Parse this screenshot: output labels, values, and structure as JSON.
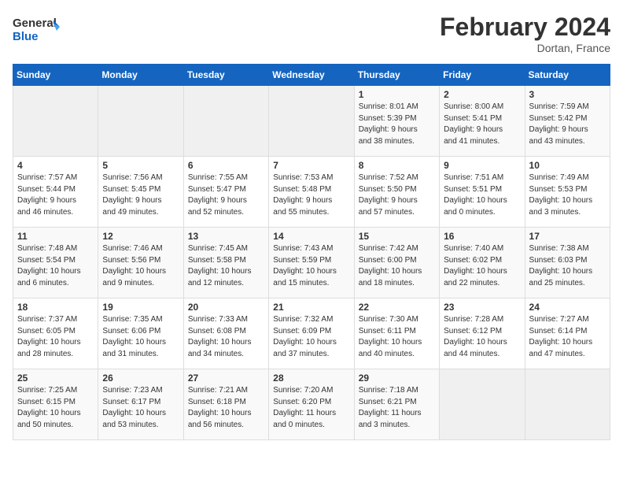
{
  "header": {
    "logo_line1": "General",
    "logo_line2": "Blue",
    "month_year": "February 2024",
    "location": "Dortan, France"
  },
  "days_of_week": [
    "Sunday",
    "Monday",
    "Tuesday",
    "Wednesday",
    "Thursday",
    "Friday",
    "Saturday"
  ],
  "weeks": [
    [
      {
        "day": "",
        "info": ""
      },
      {
        "day": "",
        "info": ""
      },
      {
        "day": "",
        "info": ""
      },
      {
        "day": "",
        "info": ""
      },
      {
        "day": "1",
        "info": "Sunrise: 8:01 AM\nSunset: 5:39 PM\nDaylight: 9 hours\nand 38 minutes."
      },
      {
        "day": "2",
        "info": "Sunrise: 8:00 AM\nSunset: 5:41 PM\nDaylight: 9 hours\nand 41 minutes."
      },
      {
        "day": "3",
        "info": "Sunrise: 7:59 AM\nSunset: 5:42 PM\nDaylight: 9 hours\nand 43 minutes."
      }
    ],
    [
      {
        "day": "4",
        "info": "Sunrise: 7:57 AM\nSunset: 5:44 PM\nDaylight: 9 hours\nand 46 minutes."
      },
      {
        "day": "5",
        "info": "Sunrise: 7:56 AM\nSunset: 5:45 PM\nDaylight: 9 hours\nand 49 minutes."
      },
      {
        "day": "6",
        "info": "Sunrise: 7:55 AM\nSunset: 5:47 PM\nDaylight: 9 hours\nand 52 minutes."
      },
      {
        "day": "7",
        "info": "Sunrise: 7:53 AM\nSunset: 5:48 PM\nDaylight: 9 hours\nand 55 minutes."
      },
      {
        "day": "8",
        "info": "Sunrise: 7:52 AM\nSunset: 5:50 PM\nDaylight: 9 hours\nand 57 minutes."
      },
      {
        "day": "9",
        "info": "Sunrise: 7:51 AM\nSunset: 5:51 PM\nDaylight: 10 hours\nand 0 minutes."
      },
      {
        "day": "10",
        "info": "Sunrise: 7:49 AM\nSunset: 5:53 PM\nDaylight: 10 hours\nand 3 minutes."
      }
    ],
    [
      {
        "day": "11",
        "info": "Sunrise: 7:48 AM\nSunset: 5:54 PM\nDaylight: 10 hours\nand 6 minutes."
      },
      {
        "day": "12",
        "info": "Sunrise: 7:46 AM\nSunset: 5:56 PM\nDaylight: 10 hours\nand 9 minutes."
      },
      {
        "day": "13",
        "info": "Sunrise: 7:45 AM\nSunset: 5:58 PM\nDaylight: 10 hours\nand 12 minutes."
      },
      {
        "day": "14",
        "info": "Sunrise: 7:43 AM\nSunset: 5:59 PM\nDaylight: 10 hours\nand 15 minutes."
      },
      {
        "day": "15",
        "info": "Sunrise: 7:42 AM\nSunset: 6:00 PM\nDaylight: 10 hours\nand 18 minutes."
      },
      {
        "day": "16",
        "info": "Sunrise: 7:40 AM\nSunset: 6:02 PM\nDaylight: 10 hours\nand 22 minutes."
      },
      {
        "day": "17",
        "info": "Sunrise: 7:38 AM\nSunset: 6:03 PM\nDaylight: 10 hours\nand 25 minutes."
      }
    ],
    [
      {
        "day": "18",
        "info": "Sunrise: 7:37 AM\nSunset: 6:05 PM\nDaylight: 10 hours\nand 28 minutes."
      },
      {
        "day": "19",
        "info": "Sunrise: 7:35 AM\nSunset: 6:06 PM\nDaylight: 10 hours\nand 31 minutes."
      },
      {
        "day": "20",
        "info": "Sunrise: 7:33 AM\nSunset: 6:08 PM\nDaylight: 10 hours\nand 34 minutes."
      },
      {
        "day": "21",
        "info": "Sunrise: 7:32 AM\nSunset: 6:09 PM\nDaylight: 10 hours\nand 37 minutes."
      },
      {
        "day": "22",
        "info": "Sunrise: 7:30 AM\nSunset: 6:11 PM\nDaylight: 10 hours\nand 40 minutes."
      },
      {
        "day": "23",
        "info": "Sunrise: 7:28 AM\nSunset: 6:12 PM\nDaylight: 10 hours\nand 44 minutes."
      },
      {
        "day": "24",
        "info": "Sunrise: 7:27 AM\nSunset: 6:14 PM\nDaylight: 10 hours\nand 47 minutes."
      }
    ],
    [
      {
        "day": "25",
        "info": "Sunrise: 7:25 AM\nSunset: 6:15 PM\nDaylight: 10 hours\nand 50 minutes."
      },
      {
        "day": "26",
        "info": "Sunrise: 7:23 AM\nSunset: 6:17 PM\nDaylight: 10 hours\nand 53 minutes."
      },
      {
        "day": "27",
        "info": "Sunrise: 7:21 AM\nSunset: 6:18 PM\nDaylight: 10 hours\nand 56 minutes."
      },
      {
        "day": "28",
        "info": "Sunrise: 7:20 AM\nSunset: 6:20 PM\nDaylight: 11 hours\nand 0 minutes."
      },
      {
        "day": "29",
        "info": "Sunrise: 7:18 AM\nSunset: 6:21 PM\nDaylight: 11 hours\nand 3 minutes."
      },
      {
        "day": "",
        "info": ""
      },
      {
        "day": "",
        "info": ""
      }
    ]
  ]
}
